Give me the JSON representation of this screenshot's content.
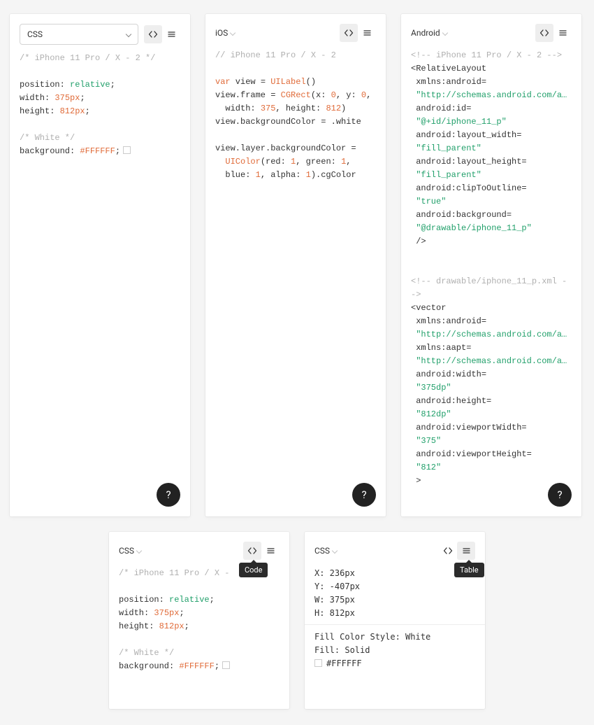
{
  "panels": {
    "css": {
      "label": "CSS",
      "comment1": "/* iPhone 11 Pro / X - 2 */",
      "l_position_k": "position: ",
      "l_position_v": "relative",
      "l_width_k": "width: ",
      "l_width_v": "375px",
      "l_height_k": "height: ",
      "l_height_v": "812px",
      "comment2": "/* White */",
      "l_bg_k": "background: ",
      "l_bg_v": "#FFFFFF"
    },
    "ios": {
      "label": "iOS",
      "comment1": "// iPhone 11 Pro / X - 2",
      "l2a": "var",
      "l2b": " view = ",
      "l2c": "UILabel",
      "l2d": "()",
      "l3a": "view.frame = ",
      "l3b": "CGRect",
      "l3c": "(x: ",
      "l3d": "0",
      "l3e": ", y: ",
      "l3f": "0",
      "l3g": ",",
      "l4a": "  width: ",
      "l4b": "375",
      "l4c": ", height: ",
      "l4d": "812",
      "l4e": ")",
      "l5": "view.backgroundColor = .white",
      "l7": "view.layer.backgroundColor =",
      "l8a": "  ",
      "l8b": "UIColor",
      "l8c": "(red: ",
      "l8d": "1",
      "l8e": ", green: ",
      "l8f": "1",
      "l8g": ",",
      "l9a": "  blue: ",
      "l9b": "1",
      "l9c": ", alpha: ",
      "l9d": "1",
      "l9e": ").cgColor"
    },
    "android": {
      "label": "Android",
      "c1": "<!-- iPhone 11 Pro / X - 2 -->",
      "l2": "<RelativeLayout",
      "l3": " xmlns:android=",
      "l3v": " \"http://schemas.android.com/a…",
      "l4": " android:id=",
      "l4v": " \"@+id/iphone_11_p\"",
      "l5": " android:layout_width=",
      "l5v": " \"fill_parent\"",
      "l6": " android:layout_height=",
      "l6v": " \"fill_parent\"",
      "l7": " android:clipToOutline=",
      "l7v": " \"true\"",
      "l8": " android:background=",
      "l8v": " \"@drawable/iphone_11_p\"",
      "l9": " />",
      "c2a": "<!-- drawable/iphone_11_p.xml -",
      "c2b": "->",
      "v1": "<vector",
      "v2": " xmlns:android=",
      "v2v": " \"http://schemas.android.com/a…",
      "v3": " xmlns:aapt=",
      "v3v": " \"http://schemas.android.com/a…",
      "v4": " android:width=",
      "v4v": " \"375dp\"",
      "v5": " android:height=",
      "v5v": " \"812dp\"",
      "v6": " android:viewportWidth=",
      "v6v": " \"375\"",
      "v7": " android:viewportHeight=",
      "v7v": " \"812\"",
      "v8": " >"
    },
    "bottom_left": {
      "label": "CSS",
      "comment1": "/* iPhone 11 Pro / X -",
      "l_position_k": "position: ",
      "l_position_v": "relative",
      "l_width_k": "width: ",
      "l_width_v": "375px",
      "l_height_k": "height: ",
      "l_height_v": "812px",
      "comment2": "/* White */",
      "l_bg_k": "background: ",
      "l_bg_v": "#FFFFFF",
      "tooltip": "Code"
    },
    "bottom_right": {
      "label": "CSS",
      "x": "X: 236px",
      "y": "Y: -407px",
      "w": "W: 375px",
      "h": "H: 812px",
      "fill_style": "Fill Color Style: White",
      "fill": "Fill: Solid",
      "fill_hex": "#FFFFFF",
      "tooltip": "Table"
    }
  },
  "help_label": "?"
}
